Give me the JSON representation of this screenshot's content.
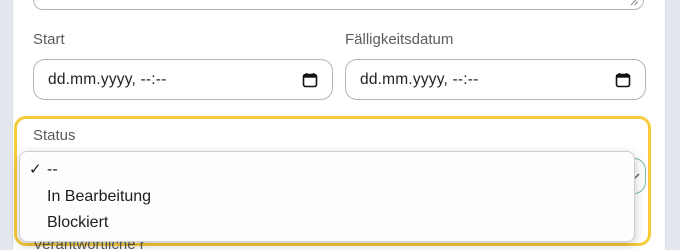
{
  "form": {
    "start_label": "Start",
    "due_label": "Fälligkeitsdatum",
    "start_placeholder": "dd.mm.yyyy, --:--",
    "due_placeholder": "dd.mm.yyyy, --:--",
    "status_label": "Status",
    "responsible_label": "Verantwortliche r"
  },
  "status_select": {
    "selected_value": "--",
    "options": [
      {
        "label": "--",
        "selected": true
      },
      {
        "label": "In Bearbeitung",
        "selected": false
      },
      {
        "label": "Blockiert",
        "selected": false
      }
    ]
  },
  "colors": {
    "focus_ring": "#f7cc3a",
    "select_border": "#7fb9a2"
  }
}
